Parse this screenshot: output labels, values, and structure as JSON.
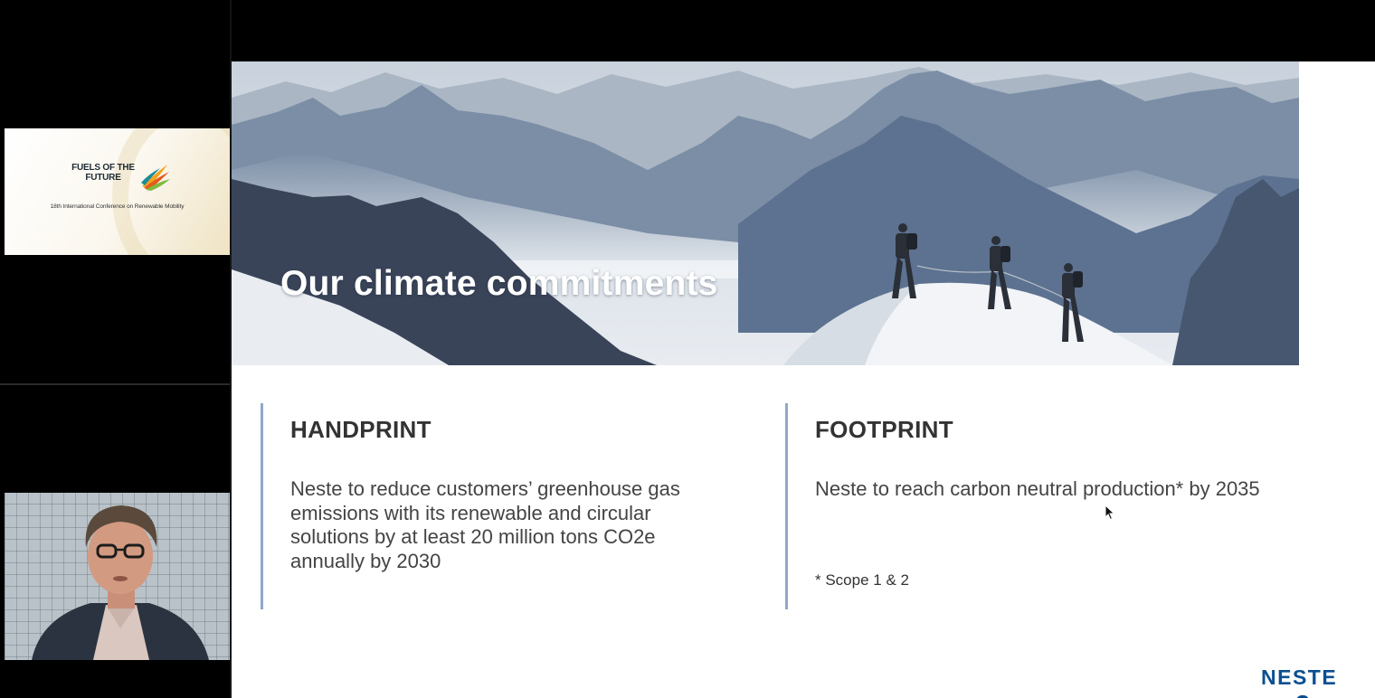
{
  "sidebar": {
    "logo": {
      "title_line1": "FUELS OF THE",
      "title_line2": "FUTURE",
      "subtitle": "18th International Conference on Renewable Mobility",
      "mark_colors": [
        "#f3a21c",
        "#e35a1c",
        "#7db93d",
        "#1a8c9b"
      ]
    },
    "speaker": {
      "shirt_color": "#d9c7c0",
      "jacket_color": "#2c3340"
    }
  },
  "slide": {
    "title": "Our climate commitments",
    "handprint": {
      "heading": "HANDPRINT",
      "body": "Neste to reduce customers’ greenhouse gas emissions with its renewable and circular solutions by at least 20 million tons CO2e annually by 2030"
    },
    "footprint": {
      "heading": "FOOTPRINT",
      "body": "Neste to reach carbon neutral production* by 2035",
      "footnote": "* Scope 1 & 2"
    },
    "brand": "NESTE",
    "accent_color": "#8fa9c8",
    "brand_color": "#0b4f91"
  }
}
